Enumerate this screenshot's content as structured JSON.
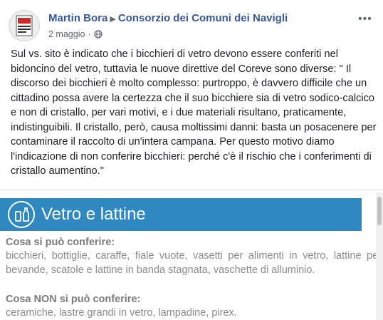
{
  "post": {
    "author": "Martin Bora",
    "group": "Consorzio dei Comuni dei Navigli",
    "date": "2 maggio",
    "privacy_icon": "globe-icon",
    "more_icon": "more-options-icon",
    "text": "Sul vs. sito è indicato che i bicchieri di vetro devono essere conferiti nel bidoncino del vetro, tuttavia le nuove direttive del Coreve sono diverse: \" Il discorso dei bicchieri è molto complesso: purtroppo, è davvero difficile che un cittadino possa avere la certezza che il suo bicchiere sia di vetro sodico-calcico e non di cristallo, per vari motivi, e i due materiali risultano, praticamente, indistinguibili. Il cristallo, però, causa moltissimi danni: basta un posacenere per contaminare il raccolto di un'intera campana. Per questo motivo diamo l'indicazione di non conferire bicchieri: perché c'è il rischio che i conferimenti di cristallo aumentino.\""
  },
  "attachment": {
    "banner_title": "Vetro e lattine",
    "banner_color": "#2f88c0",
    "allowed_heading": "Cosa si può conferire:",
    "allowed_text": "bicchieri, bottiglie, caraffe, fiale vuote, vasetti per alimenti in vetro, lattine per bevande, scatole e lattine in banda stagnata, vaschette di alluminio.",
    "not_allowed_heading": "Cosa NON si può conferire:",
    "not_allowed_text": "ceramiche, lastre grandi in vetro, lampadine, pirex."
  }
}
